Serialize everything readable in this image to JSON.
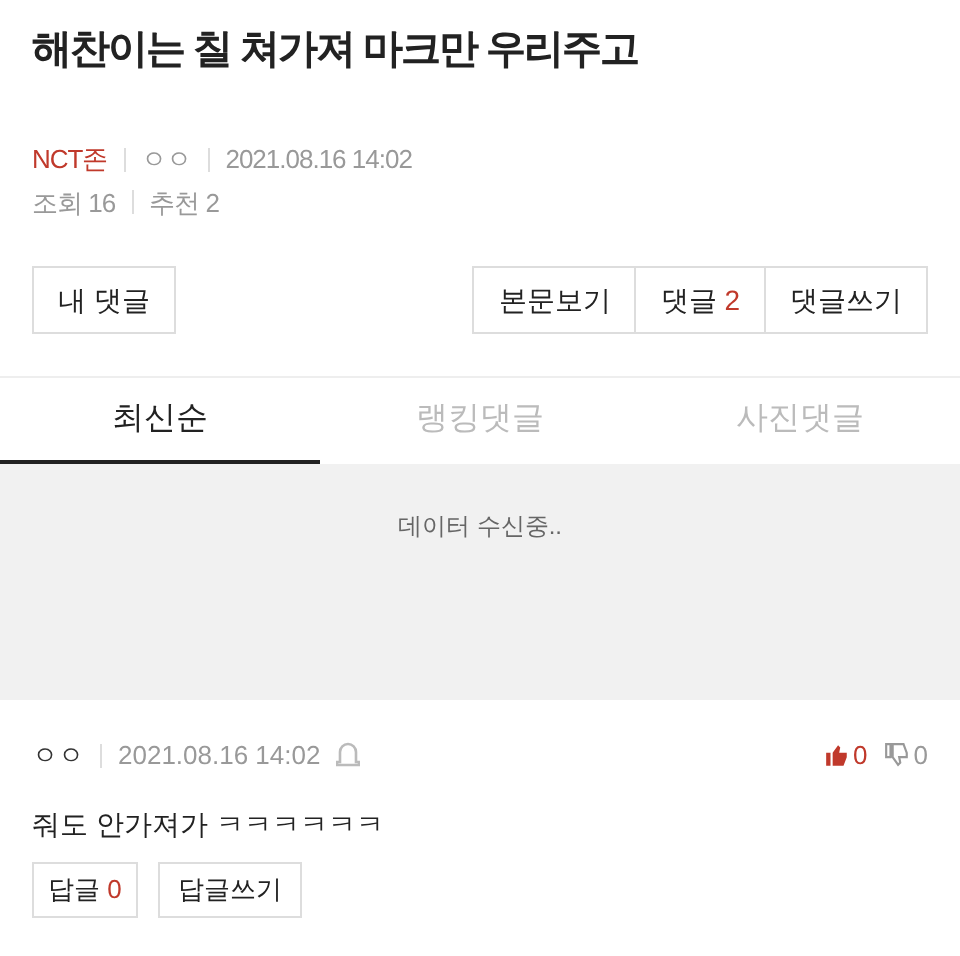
{
  "title": "해찬이는 칠 쳐가져 마크만 우리주고",
  "meta": {
    "board": "NCT존",
    "author": "ㅇㅇ",
    "date": "2021.08.16 14:02",
    "views": "조회 16",
    "recommends": "추천 2"
  },
  "my_comments_button": "내 댓글",
  "actions": [
    {
      "label": "본문보기"
    },
    {
      "label": "댓글",
      "count": "2"
    },
    {
      "label": "댓글쓰기"
    }
  ],
  "tabs": [
    {
      "label": "최신순",
      "selected": true
    },
    {
      "label": "랭킹댓글",
      "selected": false
    },
    {
      "label": "사진댓글",
      "selected": false
    }
  ],
  "loading_text": "데이터 수신중..",
  "comments": [
    {
      "author": "ㅇㅇ",
      "date": "2021.08.16 14:02",
      "likes": "0",
      "dislikes": "0",
      "text": "줘도 안가져가 ㅋㅋㅋㅋㅋㅋ",
      "reply_label": "답글",
      "reply_count": "0",
      "write_reply": "답글쓰기"
    }
  ]
}
